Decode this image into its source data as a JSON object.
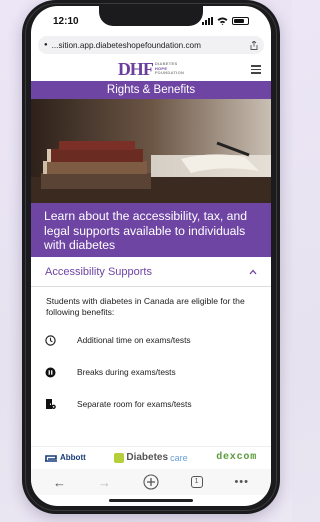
{
  "status": {
    "time": "12:10"
  },
  "browser": {
    "url": "...sition.app.diabeteshopefoundation.com"
  },
  "site": {
    "logo_mark": "DHF",
    "logo_sub": [
      "DIABETES",
      "HOPE",
      "FOUNDATION"
    ],
    "page_title": "Rights & Benefits",
    "banner_text": "Learn about the accessibility, tax, and legal supports available to individuals with diabetes"
  },
  "section": {
    "title": "Accessibility Supports",
    "intro": "Students with diabetes in Canada are eligible for the following benefits:",
    "benefits": [
      {
        "label": "Additional time on exams/tests",
        "icon": "clock-icon"
      },
      {
        "label": "Breaks during exams/tests",
        "icon": "pause-icon"
      },
      {
        "label": "Separate room for exams/tests",
        "icon": "room-icon"
      }
    ]
  },
  "sponsors": {
    "abbott": "Abbott",
    "diabetes": "Diabetes",
    "diabetes_care": "care",
    "dexcom": "Dexcom"
  },
  "toolbar": {
    "tab_count": "1"
  },
  "colors": {
    "brand_purple": "#6f45a4",
    "abbott_blue": "#163b7a",
    "dexcom_green": "#5a9a3a"
  }
}
